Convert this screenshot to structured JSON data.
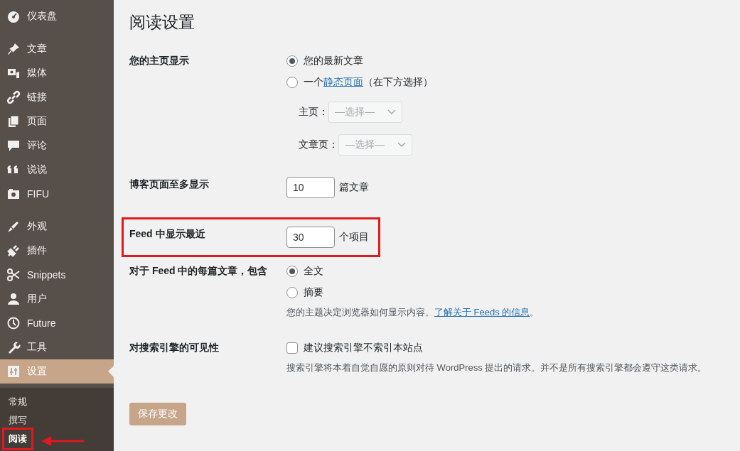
{
  "sidebar": {
    "groups": [
      [
        {
          "label": "仪表盘",
          "selected": false
        }
      ],
      [
        {
          "label": "文章",
          "selected": false
        },
        {
          "label": "媒体",
          "selected": false
        },
        {
          "label": "链接",
          "selected": false
        },
        {
          "label": "页面",
          "selected": false
        },
        {
          "label": "评论",
          "selected": false
        },
        {
          "label": "说说",
          "selected": false
        },
        {
          "label": "FIFU",
          "selected": false
        }
      ],
      [
        {
          "label": "外观",
          "selected": false
        },
        {
          "label": "插件",
          "selected": false
        },
        {
          "label": "Snippets",
          "selected": false
        },
        {
          "label": "用户",
          "selected": false
        },
        {
          "label": "Future",
          "selected": false
        },
        {
          "label": "工具",
          "selected": false
        },
        {
          "label": "设置",
          "selected": true
        }
      ]
    ],
    "submenu": [
      {
        "label": "常规",
        "selected": false,
        "highlighted": false
      },
      {
        "label": "撰写",
        "selected": false,
        "highlighted": false
      },
      {
        "label": "阅读",
        "selected": true,
        "highlighted": true
      }
    ]
  },
  "page": {
    "title": "阅读设置",
    "rows": [
      {
        "kind": "radio",
        "label": "您的主页显示",
        "highlighted": false,
        "options": [
          {
            "label": "您的最新文章",
            "selected": true
          },
          {
            "label": "一个",
            "link": "静态页面",
            "after": "（在下方选择）",
            "selected": false
          }
        ],
        "selects": [
          {
            "label": "主页：",
            "placeholder": "—选择—",
            "disabled": true
          },
          {
            "label": "文章页：",
            "placeholder": "—选择—",
            "disabled": true
          }
        ]
      },
      {
        "kind": "number",
        "label": "博客页面至多显示",
        "value": "10",
        "suffix": "篇文章",
        "highlighted": false
      },
      {
        "kind": "number",
        "label": "Feed 中显示最近",
        "value": "30",
        "suffix": "个项目",
        "highlighted": true
      },
      {
        "kind": "radio",
        "label": "对于 Feed 中的每篇文章，包含",
        "highlighted": false,
        "options": [
          {
            "label": "全文",
            "selected": true
          },
          {
            "label": "摘要",
            "selected": false
          }
        ],
        "description": "您的主题决定浏览器如何显示内容。",
        "link": "了解关于 Feeds 的信息",
        "after": "。"
      },
      {
        "kind": "checkbox",
        "label": "对搜索引擎的可见性",
        "highlighted": false,
        "checkbox": {
          "label": "建议搜索引擎不索引本站点",
          "checked": false
        },
        "description": "搜索引擎将本着自觉自愿的原则对待 WordPress 提出的请求。并不是所有搜索引擎都会遵守这类请求。"
      }
    ],
    "save_button": "保存更改"
  }
}
